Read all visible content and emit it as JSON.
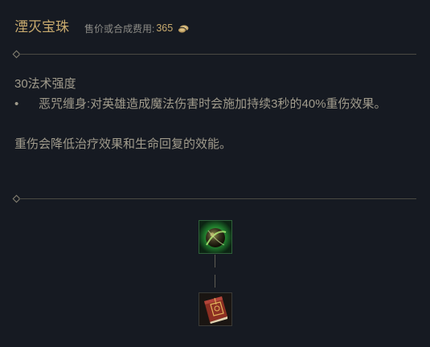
{
  "item": {
    "name": "湮灭宝珠",
    "price_label": "售价或合成费用:",
    "price_value": "365"
  },
  "description": {
    "stat": "30法术强度",
    "bullet": "•",
    "passive_name": "恶咒缠身:",
    "passive_text": "对英雄造成魔法伤害时会施加持续3秒的40%重伤效果。",
    "note": "重伤会降低治疗效果和生命回复的效能。"
  },
  "build_tree": {
    "top_icon": "oblivion-orb-icon",
    "bottom_icon": "amplifying-tome-icon"
  },
  "colors": {
    "background": "#161a22",
    "gold": "#c8aa6e",
    "text": "#a09b8c",
    "divider": "#4b4a43"
  }
}
